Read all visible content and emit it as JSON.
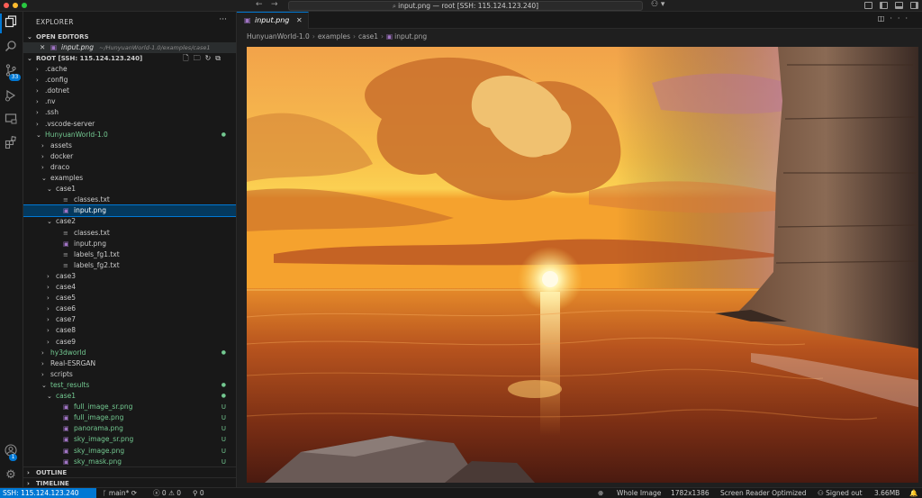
{
  "window": {
    "title": "input.png — root [SSH: 115.124.123.240]"
  },
  "activity_bar": {
    "items": [
      {
        "name": "explorer-icon"
      },
      {
        "name": "search-icon"
      },
      {
        "name": "source-control-icon",
        "badge": "33"
      },
      {
        "name": "run-debug-icon"
      },
      {
        "name": "remote-explorer-icon"
      },
      {
        "name": "extensions-icon"
      }
    ],
    "account_badge": "1"
  },
  "sidebar": {
    "title": "EXPLORER",
    "open_editors": {
      "label": "OPEN EDITORS",
      "item_name": "input.png",
      "item_path": "~/HunyuanWorld-1.0/examples/case1"
    },
    "root_label": "ROOT [SSH: 115.124.123.240]",
    "tree": [
      {
        "label": ".cache",
        "depth": 1,
        "kind": "folder",
        "open": false
      },
      {
        "label": ".config",
        "depth": 1,
        "kind": "folder",
        "open": false
      },
      {
        "label": ".dotnet",
        "depth": 1,
        "kind": "folder",
        "open": false
      },
      {
        "label": ".nv",
        "depth": 1,
        "kind": "folder",
        "open": false
      },
      {
        "label": ".ssh",
        "depth": 1,
        "kind": "folder",
        "open": false
      },
      {
        "label": ".vscode-server",
        "depth": 1,
        "kind": "folder",
        "open": false
      },
      {
        "label": "HunyuanWorld-1.0",
        "depth": 1,
        "kind": "folder",
        "open": true,
        "green": true,
        "dot": true
      },
      {
        "label": "assets",
        "depth": 2,
        "kind": "folder",
        "open": false
      },
      {
        "label": "docker",
        "depth": 2,
        "kind": "folder",
        "open": false
      },
      {
        "label": "draco",
        "depth": 2,
        "kind": "folder",
        "open": false
      },
      {
        "label": "examples",
        "depth": 2,
        "kind": "folder",
        "open": true
      },
      {
        "label": "case1",
        "depth": 3,
        "kind": "folder",
        "open": true
      },
      {
        "label": "classes.txt",
        "depth": 4,
        "kind": "txt"
      },
      {
        "label": "input.png",
        "depth": 4,
        "kind": "img",
        "selected": true
      },
      {
        "label": "case2",
        "depth": 3,
        "kind": "folder",
        "open": true
      },
      {
        "label": "classes.txt",
        "depth": 4,
        "kind": "txt"
      },
      {
        "label": "input.png",
        "depth": 4,
        "kind": "img"
      },
      {
        "label": "labels_fg1.txt",
        "depth": 4,
        "kind": "txt"
      },
      {
        "label": "labels_fg2.txt",
        "depth": 4,
        "kind": "txt"
      },
      {
        "label": "case3",
        "depth": 3,
        "kind": "folder",
        "open": false
      },
      {
        "label": "case4",
        "depth": 3,
        "kind": "folder",
        "open": false
      },
      {
        "label": "case5",
        "depth": 3,
        "kind": "folder",
        "open": false
      },
      {
        "label": "case6",
        "depth": 3,
        "kind": "folder",
        "open": false
      },
      {
        "label": "case7",
        "depth": 3,
        "kind": "folder",
        "open": false
      },
      {
        "label": "case8",
        "depth": 3,
        "kind": "folder",
        "open": false
      },
      {
        "label": "case9",
        "depth": 3,
        "kind": "folder",
        "open": false
      },
      {
        "label": "hy3dworld",
        "depth": 2,
        "kind": "folder",
        "open": false,
        "green": true,
        "dot": true
      },
      {
        "label": "Real-ESRGAN",
        "depth": 2,
        "kind": "folder",
        "open": false
      },
      {
        "label": "scripts",
        "depth": 2,
        "kind": "folder",
        "open": false
      },
      {
        "label": "test_results",
        "depth": 2,
        "kind": "folder",
        "open": true,
        "green": true,
        "dot": true
      },
      {
        "label": "case1",
        "depth": 3,
        "kind": "folder",
        "open": true,
        "green": true,
        "dot": true
      },
      {
        "label": "full_image_sr.png",
        "depth": 4,
        "kind": "img",
        "green": true,
        "status": "U"
      },
      {
        "label": "full_image.png",
        "depth": 4,
        "kind": "img",
        "green": true,
        "status": "U"
      },
      {
        "label": "panorama.png",
        "depth": 4,
        "kind": "img",
        "green": true,
        "status": "U"
      },
      {
        "label": "sky_image_sr.png",
        "depth": 4,
        "kind": "img",
        "green": true,
        "status": "U"
      },
      {
        "label": "sky_image.png",
        "depth": 4,
        "kind": "img",
        "green": true,
        "status": "U"
      },
      {
        "label": "sky_mask.png",
        "depth": 4,
        "kind": "img",
        "green": true,
        "status": "U"
      }
    ],
    "outline_label": "OUTLINE",
    "timeline_label": "TIMELINE"
  },
  "editor": {
    "tab_label": "input.png",
    "breadcrumb": [
      "HunyuanWorld-1.0",
      "examples",
      "case1",
      "input.png"
    ]
  },
  "statusbar": {
    "remote": "SSH: 115.124.123.240",
    "branch": "main*",
    "errors": "0",
    "warnings": "0",
    "ports": "0",
    "zoom": "Whole Image",
    "dimensions": "1782x1386",
    "screen_reader": "Screen Reader Optimized",
    "signed_out": "Signed out",
    "file_size": "3.66MB"
  },
  "colors": {
    "accent": "#0078d4",
    "git_untracked": "#73c991",
    "image_icon": "#a074c4"
  }
}
